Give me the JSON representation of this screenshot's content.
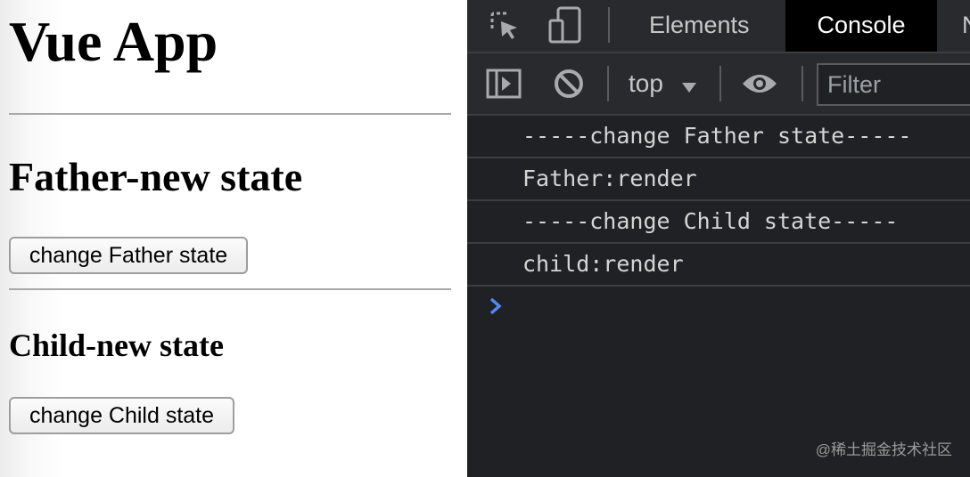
{
  "app": {
    "title": "Vue App",
    "father": {
      "heading": "Father-new state",
      "button_label": "change Father state"
    },
    "child": {
      "heading": "Child-new state",
      "button_label": "change Child state"
    }
  },
  "devtools": {
    "tabs": [
      {
        "label": "Elements",
        "active": false
      },
      {
        "label": "Console",
        "active": true
      },
      {
        "label": "N",
        "active": false
      }
    ],
    "toolbar": {
      "context": "top",
      "filter_placeholder": "Filter"
    },
    "icons": [
      "inspect-element-icon",
      "device-toggle-icon",
      "sidebar-toggle-icon",
      "clear-console-icon",
      "dropdown-arrow-icon",
      "eye-icon",
      "prompt-chevron-icon"
    ],
    "console_lines": [
      "-----change Father state-----",
      "Father:render",
      "-----change Child state-----",
      "child:render"
    ],
    "colors": {
      "panel_bg": "#202124",
      "toolbar_bg": "#292a2d",
      "active_tab_bg": "#000000",
      "prompt_chevron": "#4c8af5"
    }
  },
  "watermark": "@稀土掘金技术社区"
}
